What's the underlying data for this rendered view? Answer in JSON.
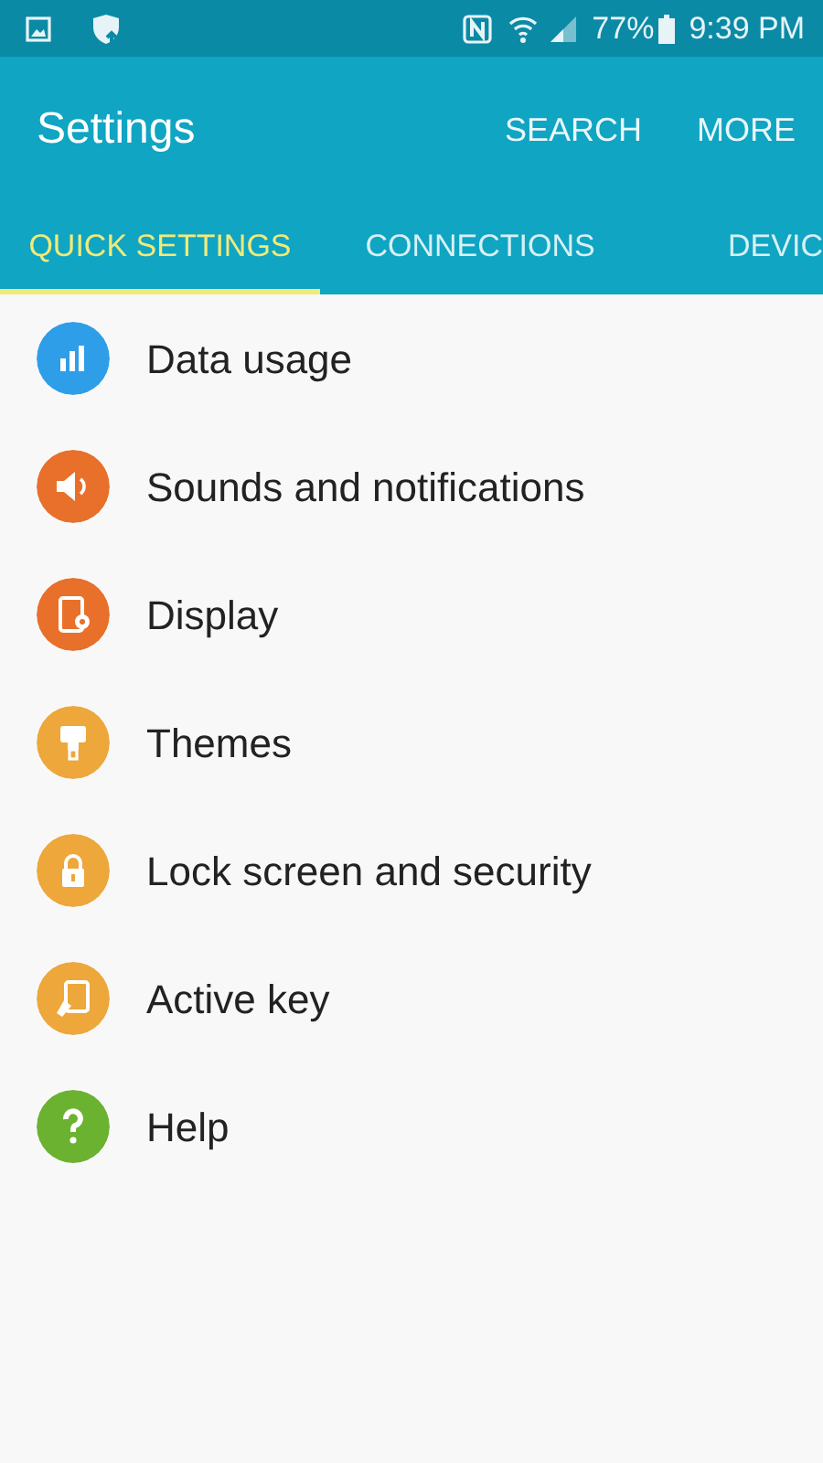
{
  "status_bar": {
    "battery_text": "77%",
    "time": "9:39 PM"
  },
  "app_bar": {
    "title": "Settings",
    "actions": [
      "SEARCH",
      "MORE"
    ]
  },
  "tabs": [
    {
      "label": "QUICK SETTINGS",
      "selected": true
    },
    {
      "label": "CONNECTIONS",
      "selected": false
    },
    {
      "label": "DEVIC",
      "selected": false
    }
  ],
  "items": [
    {
      "label": "Data usage",
      "color": "#2f9ee8"
    },
    {
      "label": "Sounds and notifications",
      "color": "#e8702a"
    },
    {
      "label": "Display",
      "color": "#e8702a"
    },
    {
      "label": "Themes",
      "color": "#eda73a"
    },
    {
      "label": "Lock screen and security",
      "color": "#eda73a"
    },
    {
      "label": "Active key",
      "color": "#eda73a"
    },
    {
      "label": "Help",
      "color": "#6bb231"
    }
  ]
}
